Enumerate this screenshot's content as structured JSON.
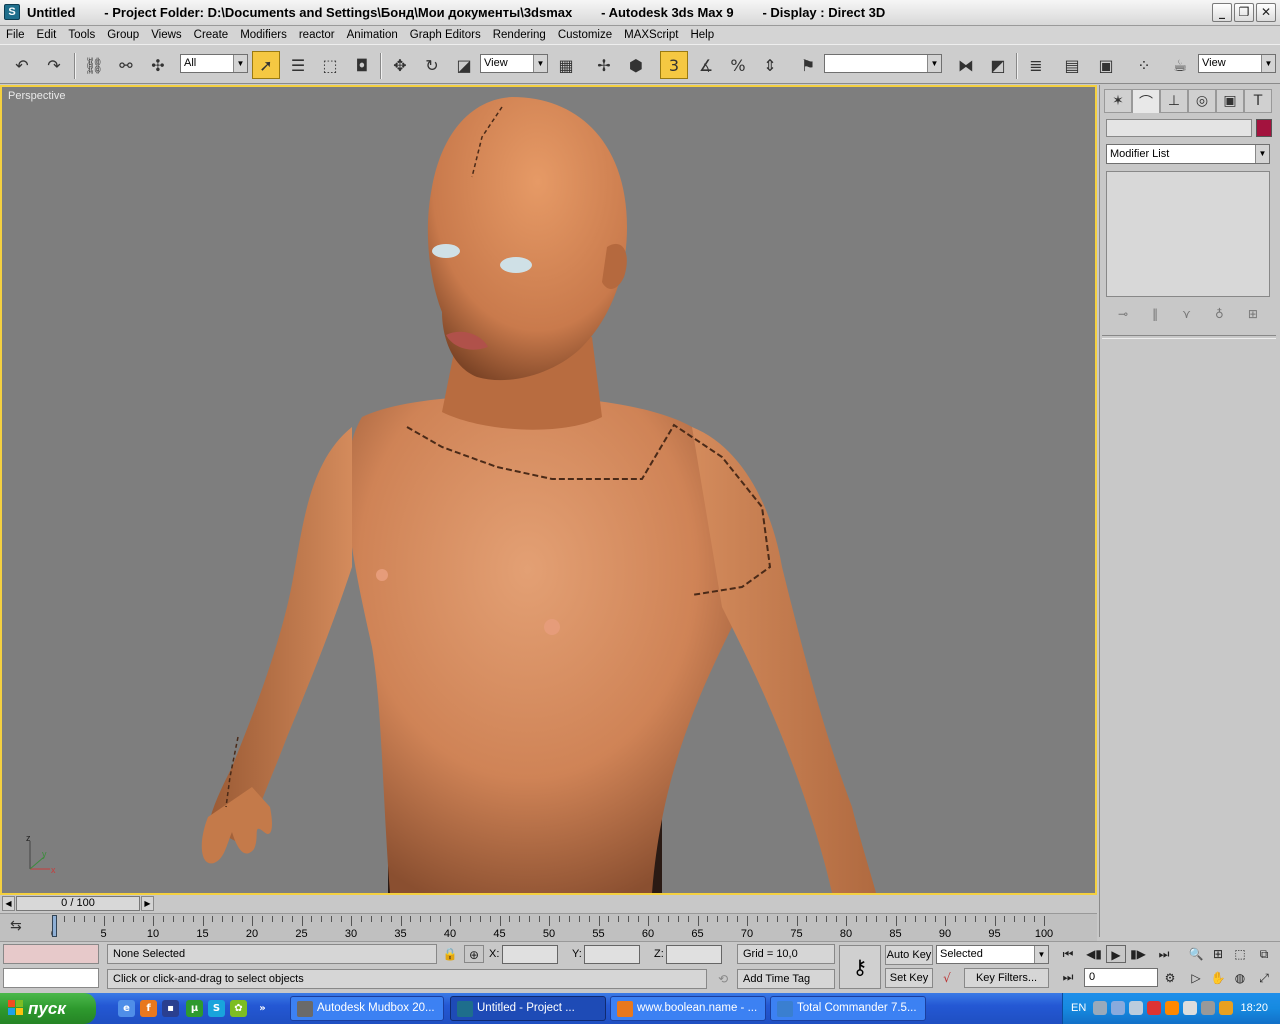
{
  "titlebar": {
    "title": "Untitled        - Project Folder: D:\\Documents and Settings\\Бонд\\Мои документы\\3dsmax        - Autodesk 3ds Max 9        - Display : Direct 3D",
    "icon": "3dsmax-app-icon",
    "minimize": "_",
    "maximize": "❐",
    "close": "✕"
  },
  "menu": {
    "items": [
      "File",
      "Edit",
      "Tools",
      "Group",
      "Views",
      "Create",
      "Modifiers",
      "reactor",
      "Animation",
      "Graph Editors",
      "Rendering",
      "Customize",
      "MAXScript",
      "Help"
    ]
  },
  "toolbar": {
    "selection_filter": "All",
    "reference_coord": "View",
    "named_selection": "",
    "render_view": "View",
    "snap_value": "3"
  },
  "viewport": {
    "label": "Perspective",
    "axis": {
      "x": "x",
      "y": "y",
      "z": "z"
    }
  },
  "command_panel": {
    "modifier_list": "Modifier List",
    "object_color": "#a3133e"
  },
  "timeline": {
    "slider_text": "0 / 100",
    "ticks": [
      0,
      5,
      10,
      15,
      20,
      25,
      30,
      35,
      40,
      45,
      50,
      55,
      60,
      65,
      70,
      75,
      80,
      85,
      90,
      95,
      100
    ],
    "range_start": 0,
    "range_end": 100
  },
  "status": {
    "selection": "None Selected",
    "prompt": "Click or click-and-drag to select objects",
    "x_label": "X:",
    "y_label": "Y:",
    "z_label": "Z:",
    "grid": "Grid = 10,0",
    "add_time_tag": "Add Time Tag",
    "auto_key": "Auto Key",
    "set_key": "Set Key",
    "key_mode": "Selected",
    "key_filters": "Key Filters...",
    "current_frame": "0"
  },
  "taskbar": {
    "start": "пуск",
    "tasks": [
      {
        "label": "Autodesk Mudbox 20...",
        "color": "#6a6a6a"
      },
      {
        "label": "Untitled      - Project ...",
        "color": "#1e6e8c"
      },
      {
        "label": "www.boolean.name - ...",
        "color": "#e8781e"
      },
      {
        "label": "Total Commander 7.5...",
        "color": "#3a7fd0"
      }
    ],
    "lang": "EN",
    "clock": "18:20"
  }
}
